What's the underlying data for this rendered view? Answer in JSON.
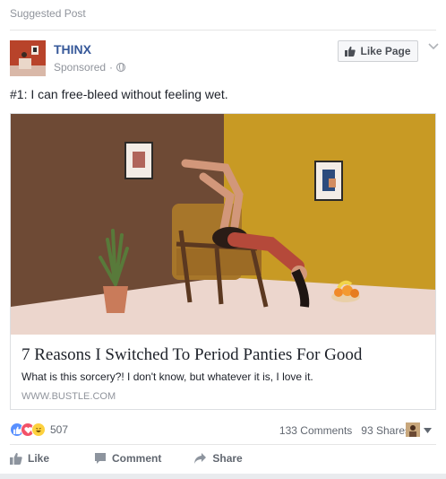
{
  "header": {
    "suggested_label": "Suggested Post"
  },
  "page": {
    "name": "THINX",
    "sponsored_label": "Sponsored",
    "separator": "·",
    "like_page_label": "Like Page"
  },
  "post": {
    "text": "#1: I can free-bleed without feeling wet."
  },
  "attachment": {
    "headline": "7 Reasons I Switched To Period Panties For Good",
    "description": "What is this sorcery?! I don't know, but whatever it is, I love it.",
    "domain": "WWW.BUSTLE.COM"
  },
  "engagement": {
    "reaction_count": "507",
    "comments": "133 Comments",
    "shares": "93 Shares",
    "reaction_icons": [
      "like-icon",
      "love-icon",
      "haha-icon"
    ]
  },
  "actions": {
    "like": "Like",
    "comment": "Comment",
    "share": "Share"
  },
  "colors": {
    "brand_link": "#365899",
    "muted": "#90949c",
    "like_blue": "#5890ff",
    "love_red": "#f25268",
    "haha_yellow": "#fdd13e"
  }
}
